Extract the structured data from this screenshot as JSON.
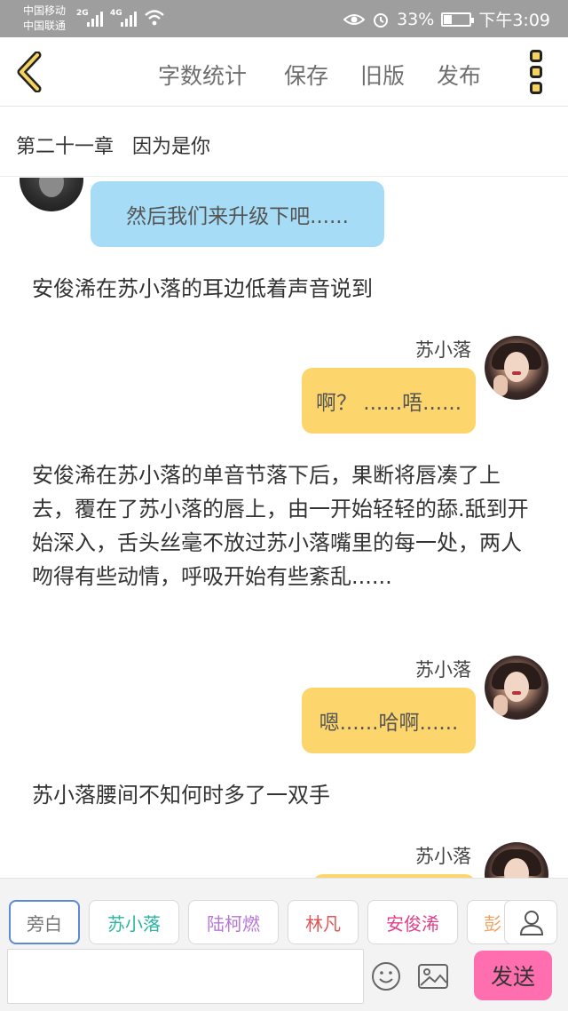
{
  "status_bar": {
    "carrier1": "中国移动",
    "carrier2": "中国联通",
    "net1": "2G",
    "net2": "4G",
    "battery_percent": "33%",
    "battery_level": 0.33,
    "time": "下午3:09"
  },
  "toolbar": {
    "word_count": "字数统计",
    "save": "保存",
    "old_version": "旧版",
    "publish": "发布"
  },
  "chapter": {
    "title": "第二十一章   因为是你"
  },
  "messages": {
    "m1": {
      "text": "然后我们来升级下吧......"
    },
    "n1": "安俊浠在苏小落的耳边低着声音说到",
    "m2": {
      "speaker": "苏小落",
      "text": "啊？ ......唔......"
    },
    "n2": "安俊浠在苏小落的单音节落下后，果断将唇凑了上去，覆在了苏小落的唇上，由一开始轻轻的舔.舐到开始深入，舌头丝毫不放过苏小落嘴里的每一处，两人吻得有些动情，呼吸开始有些紊乱......",
    "m3": {
      "speaker": "苏小落",
      "text": "嗯......哈啊......"
    },
    "n3": "苏小落腰间不知何时多了一双手",
    "m4": {
      "speaker": "苏小落"
    }
  },
  "roles": [
    {
      "label": "旁白",
      "color": "#777777"
    },
    {
      "label": "苏小落",
      "color": "#2cb5a0"
    },
    {
      "label": "陆柯燃",
      "color": "#b777d6"
    },
    {
      "label": "林凡",
      "color": "#e05555"
    },
    {
      "label": "安俊浠",
      "color": "#e03f8a"
    },
    {
      "label": "彭",
      "color": "#f0a060"
    }
  ],
  "input": {
    "send": "发送"
  }
}
